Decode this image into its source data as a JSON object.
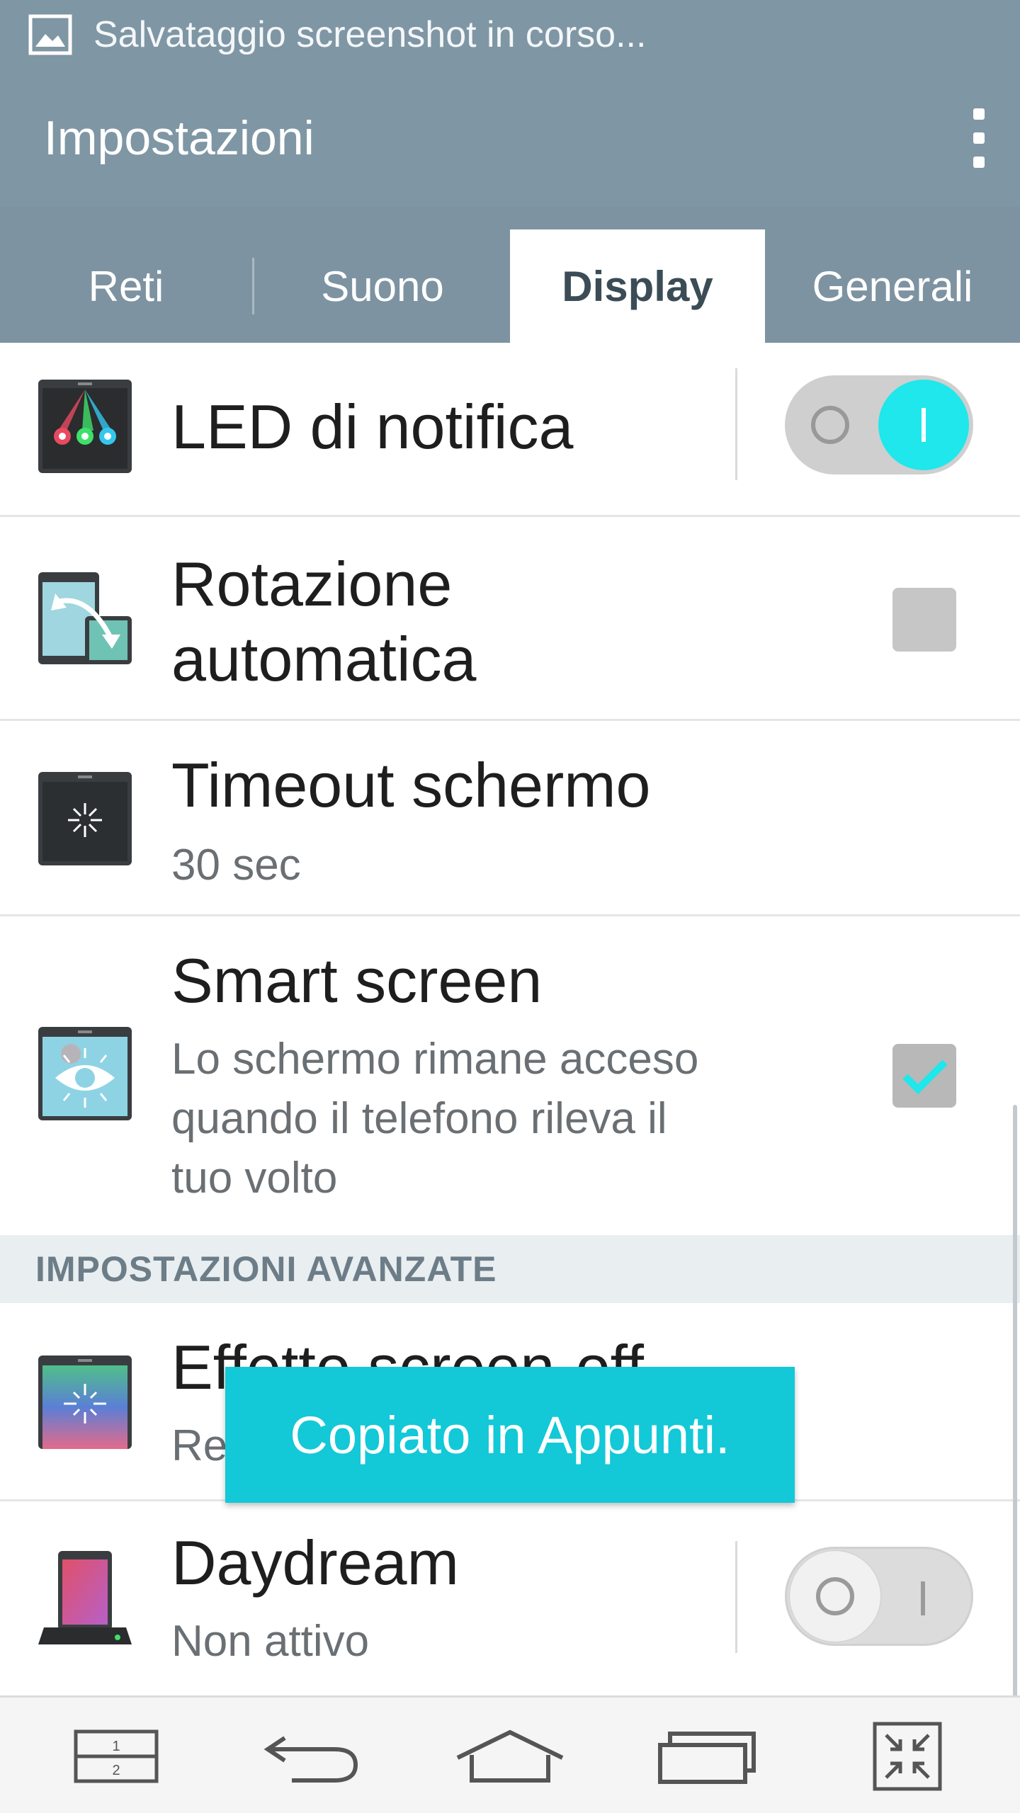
{
  "status_bar": {
    "text": "Salvataggio screenshot in corso..."
  },
  "action_bar": {
    "title": "Impostazioni"
  },
  "tabs": [
    {
      "label": "Reti"
    },
    {
      "label": "Suono"
    },
    {
      "label": "Display",
      "active": true
    },
    {
      "label": "Generali"
    }
  ],
  "rows": {
    "led": {
      "title": "LED di notifica",
      "switch_on": true,
      "icon": "led-notification-icon"
    },
    "rotation": {
      "title_line1": "Rotazione",
      "title_line2": "automatica",
      "checked": false,
      "icon": "auto-rotate-icon"
    },
    "timeout": {
      "title": "Timeout schermo",
      "value": "30 sec",
      "icon": "screen-timeout-icon"
    },
    "smart": {
      "title": "Smart screen",
      "desc_line1": "Lo schermo rimane acceso",
      "desc_line2": "quando il telefono rileva il",
      "desc_line3": "tuo volto",
      "checked": true,
      "icon": "smart-screen-eye-icon"
    },
    "effect": {
      "title": "Effetto screen-off",
      "value": "Retro TV",
      "icon": "screen-off-effect-icon"
    },
    "daydream": {
      "title": "Daydream",
      "value": "Non attivo",
      "switch_on": false,
      "icon": "daydream-dock-icon"
    }
  },
  "section": {
    "advanced": "IMPOSTAZIONI AVANZATE"
  },
  "toast": {
    "text": "Copiato in Appunti."
  },
  "nav": {
    "dual_window_label_1": "1",
    "dual_window_label_2": "2"
  },
  "colors": {
    "header": "#7f96a4",
    "accent": "#1fe7eb",
    "toast": "#13c8d7",
    "section_bg": "#e9eef1"
  }
}
